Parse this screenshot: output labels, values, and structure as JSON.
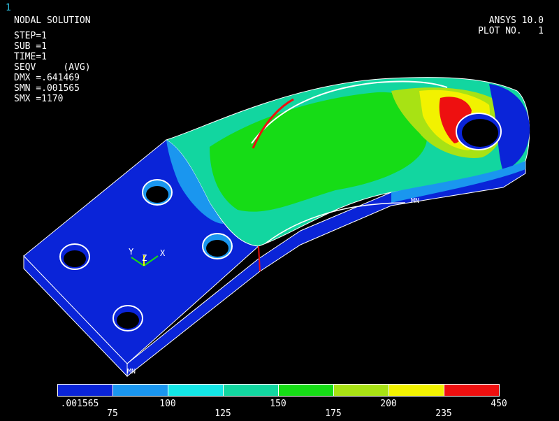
{
  "window": {
    "number": "1"
  },
  "header": {
    "title": "NODAL SOLUTION",
    "version": "ANSYS 10.0",
    "plot": "PLOT NO.   1"
  },
  "params": [
    "STEP=1",
    "SUB =1",
    "TIME=1",
    "SEQV     (AVG)",
    "DMX =.641469",
    "SMN =.001565",
    "SMX =1170"
  ],
  "markers": {
    "min1": "MN",
    "min2": "MN"
  },
  "triad": {
    "y": "Y",
    "z": "Z",
    "x": "X"
  },
  "legend": {
    "colors": [
      "#0a24d8",
      "#1a96ef",
      "#13e6e6",
      "#12d6a0",
      "#16dc16",
      "#a8e214",
      "#f2f200",
      "#ee1010"
    ],
    "labels_bottom": [
      ".001565",
      "100",
      "150",
      "200",
      "450"
    ],
    "labels_top": [
      "75",
      "125",
      "175",
      "235"
    ]
  }
}
